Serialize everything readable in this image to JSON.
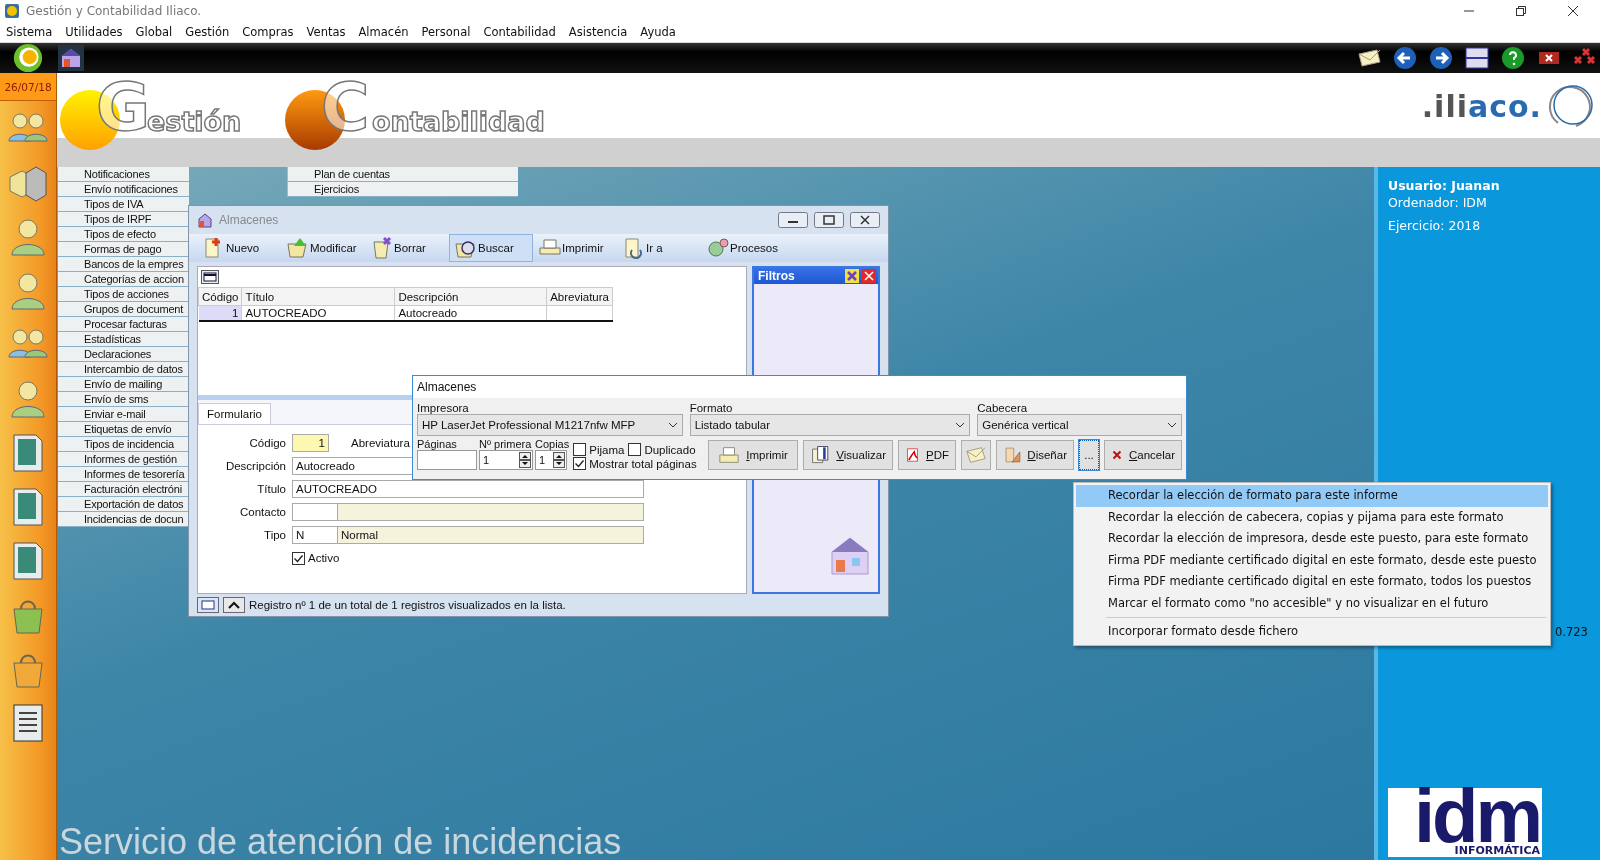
{
  "window": {
    "title": "Gestión y Contabilidad Iliaco."
  },
  "menu": [
    "Sistema",
    "Utilidades",
    "Global",
    "Gestión",
    "Compras",
    "Ventas",
    "Almacén",
    "Personal",
    "Contabilidad",
    "Asistencia",
    "Ayuda"
  ],
  "date": "26/07/18",
  "brands": [
    {
      "initial": "G",
      "rest": "estión"
    },
    {
      "initial": "C",
      "rest": "ontabilidad"
    }
  ],
  "logo": ".iliaco.",
  "menu_list": {
    "column_1": [
      "Notificaciones",
      "Envío notificaciones",
      "Tipos de IVA",
      "Tipos de IRPF",
      "Tipos de efecto",
      "Formas de pago",
      "Bancos de la empres",
      "Categorías de accion",
      "Tipos de acciones",
      "Grupos de document",
      "Procesar facturas",
      "Estadísticas",
      "Declaraciones",
      "Intercambio de datos",
      "Envío de mailing",
      "Envío de sms",
      "Enviar e-mail",
      "Etiquetas de envío",
      "Tipos de incidencia",
      "Informes de gestión",
      "Informes de tesorería",
      "Facturación electróni",
      "Exportación de datos",
      "Incidencias de docun"
    ],
    "column_2": [
      "Plan de cuentas",
      "Ejercicios"
    ]
  },
  "user_panel": {
    "user": "Usuario: Juanan",
    "computer": "Ordenador: IDM",
    "year": "Ejercicio: 2018",
    "version": "0.723"
  },
  "footer_text": "Servicio de atención de incidencias",
  "company": {
    "name": "idm",
    "tagline": "INFORMÁTICA"
  },
  "almacenes_window": {
    "title": "Almacenes",
    "toolbar": [
      {
        "label": "Nuevo",
        "kind": "new",
        "selected": false
      },
      {
        "label": "Modificar",
        "kind": "edit",
        "selected": false
      },
      {
        "label": "Borrar",
        "kind": "delete",
        "selected": false
      },
      {
        "label": "Buscar",
        "kind": "search",
        "selected": true
      },
      {
        "label": "Imprimir",
        "kind": "print",
        "selected": false
      },
      {
        "label": "Ir a",
        "kind": "goto",
        "selected": false
      },
      {
        "label": "Procesos",
        "kind": "process",
        "selected": false
      }
    ],
    "table": {
      "columns": [
        "Código",
        "Título",
        "Descripción",
        "Abreviatura"
      ],
      "rows": [
        {
          "cells": [
            "1",
            "AUTOCREADO",
            "Autocreado"
          ]
        }
      ]
    },
    "filters": {
      "title": "Filtros"
    },
    "tabs": [
      {
        "label": "Formulario",
        "selected": true
      }
    ],
    "form": {
      "code_label": "Código",
      "code": "1",
      "abbr_label": "Abreviatura",
      "desc_label": "Descripción",
      "desc": "Autocreado",
      "title_label": "Título",
      "title": "AUTOCREADO",
      "contact_label": "Contacto",
      "type_label": "Tipo",
      "type_code": "N",
      "type_name": "Normal",
      "active": {
        "label": "Activo",
        "checked": true
      }
    },
    "status": "Registro nº 1 de un total de 1 registros visualizados en la lista."
  },
  "print_dialog": {
    "title": "Almacenes",
    "selects": [
      {
        "label": "Impresora",
        "value": "HP LaserJet Professional M1217nfw MFP"
      },
      {
        "label": "Formato",
        "value": "Listado tabular"
      },
      {
        "label": "Cabecera",
        "value": "Genérica vertical"
      }
    ],
    "pages": {
      "label": "Páginas"
    },
    "first": {
      "label": "Nº primera",
      "value": "1"
    },
    "copies": {
      "label": "Copias",
      "value": "1"
    },
    "checks": [
      {
        "label": "Pijama",
        "checked": false
      },
      {
        "label": "Duplicado",
        "checked": false
      },
      {
        "label": "Mostrar total páginas",
        "checked": true
      }
    ],
    "buttons": [
      {
        "label": "Imprimir",
        "kind": "print"
      },
      {
        "label": "Visualizar",
        "kind": "preview"
      },
      {
        "label": "PDF",
        "kind": "pdf"
      },
      {
        "kind": "mail"
      },
      {
        "label": "Diseñar",
        "kind": "design"
      },
      {
        "label": "...",
        "kind": "more"
      },
      {
        "label": "Cancelar",
        "kind": "cancel"
      }
    ]
  },
  "context_menu": [
    {
      "kind": "item",
      "label": "Recordar la elección de formato para este informe",
      "selected": true
    },
    {
      "kind": "item",
      "label": "Recordar la elección de cabecera, copias y pijama para este formato",
      "selected": false
    },
    {
      "kind": "item",
      "label": "Recordar la elección de impresora, desde este puesto, para este formato",
      "selected": false
    },
    {
      "kind": "item",
      "label": "Firma PDF mediante certificado digital en este formato, desde este puesto",
      "selected": false
    },
    {
      "kind": "item",
      "label": "Firma PDF mediante certificado digital en este formato, todos los puestos",
      "selected": false
    },
    {
      "kind": "item",
      "label": "Marcar el formato como \"no accesible\" y no visualizar en el futuro",
      "selected": false
    },
    {
      "kind": "separator"
    },
    {
      "kind": "item",
      "label": "Incorporar formato desde fichero",
      "selected": false
    }
  ]
}
